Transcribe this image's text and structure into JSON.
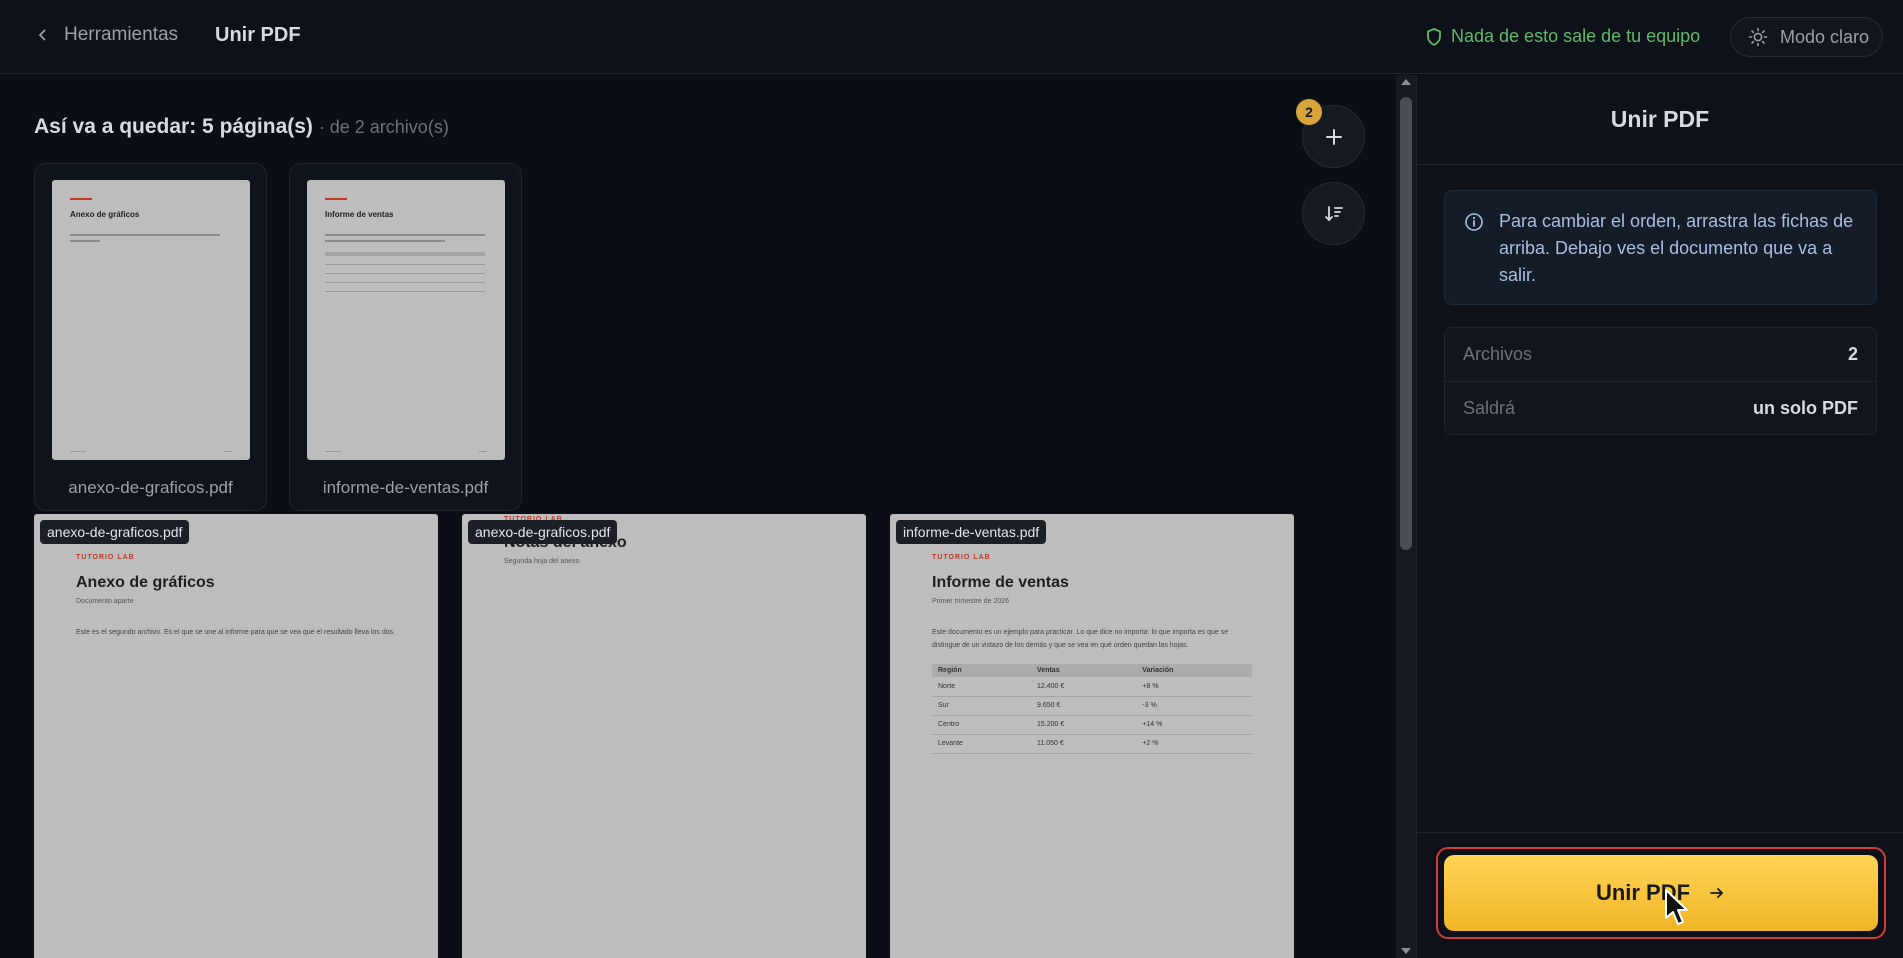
{
  "header": {
    "back_label": "Herramientas",
    "title": "Unir PDF",
    "privacy_note": "Nada de esto sale de tu equipo",
    "mode_toggle": "Modo claro"
  },
  "main": {
    "summary_strong": "Así va a quedar: 5 página(s)",
    "summary_muted": "· de 2 archivo(s)",
    "files": [
      {
        "name": "anexo-de-graficos.pdf",
        "thumb_title": "Anexo de gráficos"
      },
      {
        "name": "informe-de-ventas.pdf",
        "thumb_title": "Informe de ventas"
      }
    ],
    "file_count_badge": "2",
    "add_icon": "plus-icon",
    "sort_icon": "sort-icon"
  },
  "preview": {
    "pages": [
      {
        "label": "anexo-de-graficos.pdf",
        "tag": "TUTORIO LAB",
        "title": "Anexo de gráficos",
        "subtitle": "Documento aparte",
        "body": "Este es el segundo archivo. Es el que se une al informe para que se vea que el resultado lleva los dos."
      },
      {
        "label": "anexo-de-graficos.pdf",
        "tag": "TUTORIO LAB",
        "title": "Notas del anexo",
        "subtitle": "Segunda hoja del anexo"
      },
      {
        "label": "informe-de-ventas.pdf",
        "tag": "TUTORIO LAB",
        "title": "Informe de ventas",
        "subtitle": "Primer trimestre de 2026",
        "body": "Este documento es un ejemplo para practicar. Lo que dice no importa: lo que importa es que se distingue de un vistazo de los demás y que se vea en qué orden quedan las hojas.",
        "table": {
          "headers": [
            "Región",
            "Ventas",
            "Variación"
          ],
          "rows": [
            [
              "Norte",
              "12.400 €",
              "+8 %"
            ],
            [
              "Sur",
              "9.650 €",
              "-3 %"
            ],
            [
              "Centro",
              "15.200 €",
              "+14 %"
            ],
            [
              "Levante",
              "11.050 €",
              "+2 %"
            ]
          ]
        }
      }
    ]
  },
  "panel": {
    "title": "Unir PDF",
    "info": "Para cambiar el orden, arrastra las fichas de arriba. Debajo ves el documento que va a salir.",
    "stats": [
      {
        "key": "Archivos",
        "value": "2"
      },
      {
        "key": "Saldrá",
        "value": "un solo PDF"
      }
    ],
    "cta_label": "Unir PDF"
  },
  "colors": {
    "background": "#0b0e14",
    "accent": "#f5c23a",
    "privacy_green": "#5fb96c",
    "info_text": "#a9bde0",
    "focus_ring": "#d23b3b"
  }
}
